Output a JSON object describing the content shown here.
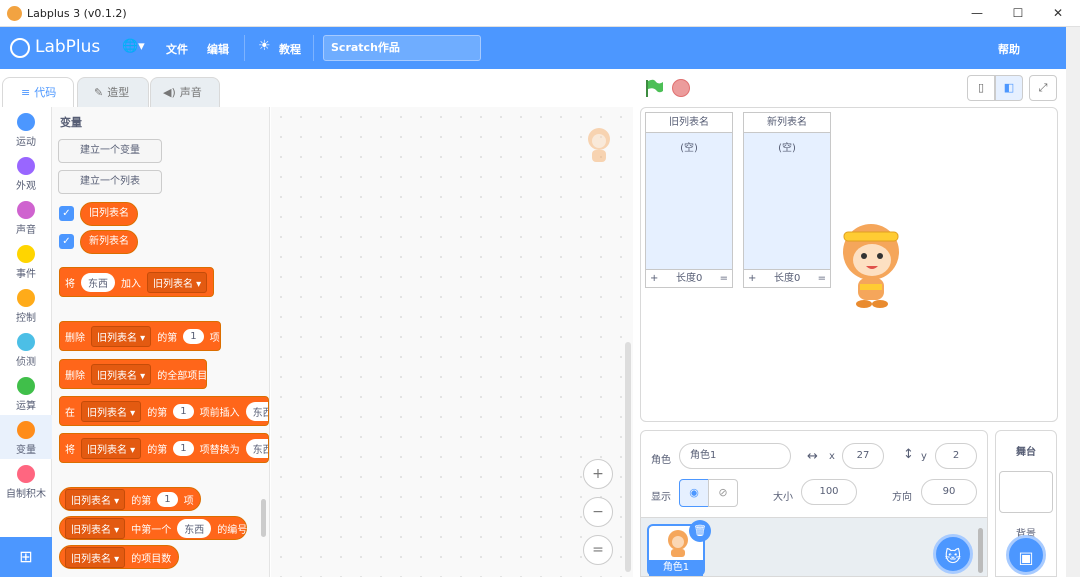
{
  "window": {
    "title": "Labplus 3 (v0.1.2)",
    "min": "—",
    "max": "☐",
    "close": "✕"
  },
  "menu": {
    "logo": "LabPlus",
    "globe": "🌐▾",
    "file": "文件",
    "edit": "编辑",
    "tutorial": "教程",
    "project_name": "Scratch作品",
    "help": "帮助"
  },
  "tabs": [
    {
      "label": "代码"
    },
    {
      "label": "造型"
    },
    {
      "label": "声音"
    }
  ],
  "categories": [
    {
      "label": "运动",
      "color": "#4c97ff"
    },
    {
      "label": "外观",
      "color": "#9966ff"
    },
    {
      "label": "声音",
      "color": "#cf63cf"
    },
    {
      "label": "事件",
      "color": "#ffd500"
    },
    {
      "label": "控制",
      "color": "#ffab19"
    },
    {
      "label": "侦测",
      "color": "#4cbfe6"
    },
    {
      "label": "运算",
      "color": "#40bf4a"
    },
    {
      "label": "变量",
      "color": "#ff8c1a"
    },
    {
      "label": "自制积木",
      "color": "#ff6680"
    }
  ],
  "palette": {
    "heading": "变量",
    "make_variable": "建立一个变量",
    "make_list": "建立一个列表",
    "list1": "旧列表名",
    "list2": "新列表名",
    "add": {
      "w1": "将",
      "item": "东西",
      "w2": "加入",
      "list": "旧列表名 ▾"
    },
    "del": {
      "w1": "删除",
      "list": "旧列表名 ▾",
      "w2": "的第",
      "n": "1",
      "w3": "项"
    },
    "delall": {
      "w1": "删除",
      "list": "旧列表名 ▾",
      "w2": "的全部项目"
    },
    "insert": {
      "w1": "在",
      "list": "旧列表名 ▾",
      "w2": "的第",
      "n": "1",
      "w3": "项前插入",
      "item": "东西"
    },
    "replace": {
      "w1": "将",
      "list": "旧列表名 ▾",
      "w2": "的第",
      "n": "1",
      "w3": "项替换为",
      "item": "东西"
    },
    "itemof": {
      "list": "旧列表名 ▾",
      "w1": "的第",
      "n": "1",
      "w2": "项"
    },
    "indexof": {
      "list": "旧列表名 ▾",
      "w1": "中第一个",
      "item": "东西",
      "w2": "的编号"
    },
    "length": {
      "list": "旧列表名 ▾",
      "w1": "的项目数"
    }
  },
  "zoom": {
    "in": "+",
    "out": "−",
    "reset": "="
  },
  "monitors": [
    {
      "name": "旧列表名",
      "empty": "(空)",
      "plus": "+",
      "length": "长度0",
      "eq": "="
    },
    {
      "name": "新列表名",
      "empty": "(空)",
      "plus": "+",
      "length": "长度0",
      "eq": "="
    }
  ],
  "sprite_info": {
    "sprite_label": "角色",
    "sprite_name": "角色1",
    "x_label": "x",
    "x": "27",
    "y_label": "y",
    "y": "2",
    "show_label": "显示",
    "size_label": "大小",
    "size": "100",
    "direction_label": "方向",
    "direction": "90"
  },
  "sprite_tile": {
    "name": "角色1"
  },
  "stage_panel": {
    "title": "舞台",
    "backdrop": "背景"
  }
}
